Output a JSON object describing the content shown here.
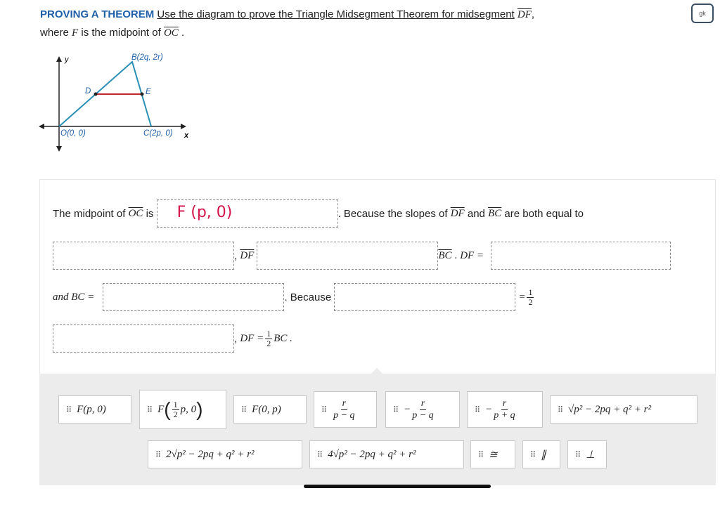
{
  "header": {
    "title": "PROVING A THEOREM",
    "line1_pre": "Use the diagram to prove the Triangle Midsegment Theorem for midsegment",
    "line1_seg": "DF",
    "line1_post": ",",
    "line2_pre": "where",
    "line2_var": "F",
    "line2_mid": "is the midpoint of",
    "line2_seg": "OC",
    "line2_post": ".",
    "corner_label": "gk"
  },
  "diagram": {
    "axis_y": "y",
    "axis_x": "x",
    "point_b": "B(2q, 2r)",
    "point_d": "D",
    "point_e": "E",
    "point_o": "O(0, 0)",
    "point_c": "C(2p, 0)",
    "colors": {
      "triangle": "#2a8fb5",
      "midsegment": "#c0282d"
    }
  },
  "proof": {
    "r1_text1": "The midpoint of",
    "r1_seg": "OC",
    "r1_text2": "is",
    "r1_answer": "F (p, 0)",
    "r1_text3": ". Because the slopes of",
    "r1_seg2": "DF",
    "r1_and": "and",
    "r1_seg3": "BC",
    "r1_text4": "are both equal to",
    "r2_comma": ",",
    "r2_seg": "DF",
    "r2_seg2": "BC",
    "r2_text": ". DF =",
    "r3_text1": "and BC =",
    "r3_text2": ". Because",
    "r3_eq": "=",
    "r3_num": "1",
    "r3_den": "2",
    "r4_comma": ",",
    "r4_text1": "DF =",
    "r4_num": "1",
    "r4_den": "2",
    "r4_text2": "BC ."
  },
  "tiles": {
    "t1": "F(p, 0)",
    "t2_pre": "F",
    "t2_num": "1",
    "t2_den": "2",
    "t2_post": "p, 0",
    "t3": "F(0, p)",
    "t4_num": "r",
    "t4_den": "p − q",
    "t5_sign": "−",
    "t5_num": "r",
    "t5_den": "p − q",
    "t6_sign": "−",
    "t6_num": "r",
    "t6_den": "p + q",
    "t7": "√p² − 2pq + q² + r²",
    "t8": "2√p² − 2pq + q² + r²",
    "t9": "4√p² − 2pq + q² + r²",
    "t10": "≅",
    "t11": "∥",
    "t12": "⊥"
  },
  "grip": "⠿"
}
